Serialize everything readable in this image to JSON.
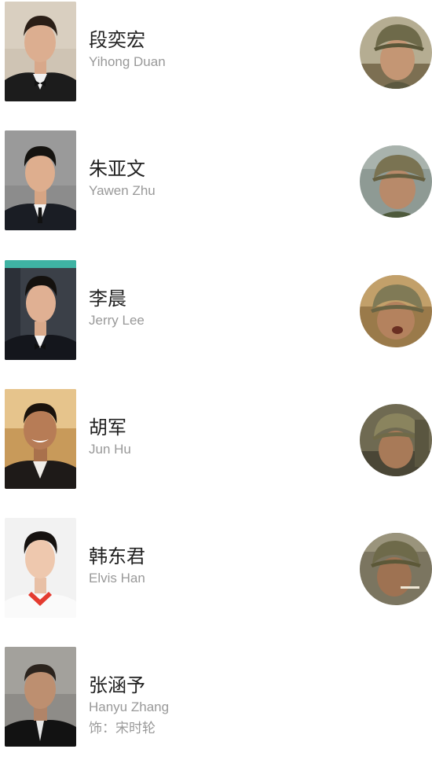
{
  "cast": [
    {
      "name": "段奕宏",
      "name_en": "Yihong Duan",
      "role": ""
    },
    {
      "name": "朱亚文",
      "name_en": "Yawen Zhu",
      "role": ""
    },
    {
      "name": "李晨",
      "name_en": "Jerry Lee",
      "role": ""
    },
    {
      "name": "胡军",
      "name_en": "Jun Hu",
      "role": ""
    },
    {
      "name": "韩东君",
      "name_en": "Elvis Han",
      "role": ""
    },
    {
      "name": "张涵予",
      "name_en": "Hanyu Zhang",
      "role": "饰：宋时轮"
    }
  ],
  "colors": {
    "name": "#222222",
    "secondary": "#999999",
    "background": "#ffffff"
  }
}
